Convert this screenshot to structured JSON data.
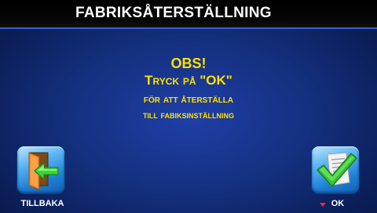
{
  "header": {
    "title": "FABRIKSÅTERSTÄLLNING"
  },
  "message": {
    "line1": "OBS!",
    "line2": "Tryck på \"OK\"",
    "line3": "för att återställa",
    "line4": "till fabiksinställning"
  },
  "buttons": {
    "back": {
      "label": "TILLBAKA",
      "icon": "door-exit-icon"
    },
    "ok": {
      "label": "OK",
      "icon": "document-check-icon"
    }
  },
  "colors": {
    "message_text": "#ffe000",
    "background": "#14307f",
    "title_bar": "#000000"
  }
}
